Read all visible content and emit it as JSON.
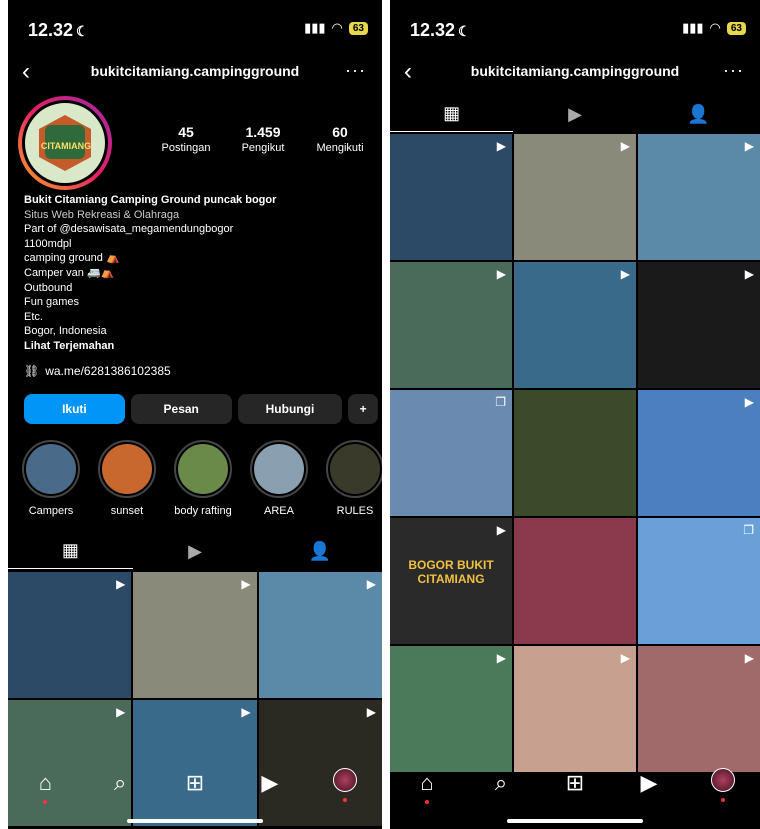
{
  "status": {
    "time": "12.32",
    "battery": "63"
  },
  "profile": {
    "username": "bukitcitamiang.campingground",
    "avatar_text": "CITAMIANG",
    "stats": [
      {
        "num": "45",
        "label": "Postingan"
      },
      {
        "num": "1.459",
        "label": "Pengikut"
      },
      {
        "num": "60",
        "label": "Mengikuti"
      }
    ],
    "bio": {
      "name": "Bukit Citamiang Camping Ground puncak bogor",
      "category": "Situs Web Rekreasi & Olahraga",
      "lines": [
        "Part of @desawisata_megamendungbogor",
        "1100mdpl",
        "camping ground ⛺",
        "Camper van 🚐⛺",
        "Outbound",
        "Fun games",
        "Etc.",
        "Bogor, Indonesia"
      ],
      "translate": "Lihat Terjemahan"
    },
    "link": "wa.me/6281386102385",
    "buttons": {
      "follow": "Ikuti",
      "message": "Pesan",
      "contact": "Hubungi",
      "add": "+"
    },
    "highlights": [
      {
        "label": "Campers",
        "color": "#4a6a8a"
      },
      {
        "label": "sunset",
        "color": "#c8682e"
      },
      {
        "label": "body rafting",
        "color": "#6a8a4a"
      },
      {
        "label": "AREA",
        "color": "#8aa0b0"
      },
      {
        "label": "RULES",
        "color": "#3a3a2a"
      }
    ]
  },
  "tabs": {
    "posts": "▦",
    "reels": "▶",
    "tagged": "👤"
  },
  "left_grid": [
    {
      "color": "#2c4a66",
      "icon": "▶"
    },
    {
      "color": "#8a8a7a",
      "icon": "▶"
    },
    {
      "color": "#5a8aa8",
      "icon": "▶"
    },
    {
      "color": "#4a6a5a",
      "icon": "▶"
    },
    {
      "color": "#3a6a8a",
      "icon": "▶"
    },
    {
      "color": "#2a2a22",
      "icon": "▶"
    }
  ],
  "right_grid": [
    {
      "color": "#2c4a66",
      "icon": "▶"
    },
    {
      "color": "#8a8a7a",
      "icon": "▶"
    },
    {
      "color": "#5a8aa8",
      "icon": "▶"
    },
    {
      "color": "#4a6a5a",
      "icon": "▶"
    },
    {
      "color": "#3a6a8a",
      "icon": "▶"
    },
    {
      "color": "#1a1a1a",
      "icon": "▶"
    },
    {
      "color": "#6a8ab0",
      "icon": "❐"
    },
    {
      "color": "#3a4a2a",
      "icon": ""
    },
    {
      "color": "#4a80c0",
      "icon": "▶"
    },
    {
      "color": "#2a2a2a",
      "icon": "▶",
      "text": "BOGOR BUKIT CITAMIANG"
    },
    {
      "color": "#8a3a4a",
      "icon": ""
    },
    {
      "color": "#6aa0d8",
      "icon": "❐"
    },
    {
      "color": "#4a7a5a",
      "icon": "▶"
    },
    {
      "color": "#c8a090",
      "icon": "▶"
    },
    {
      "color": "#a06a6a",
      "icon": "▶"
    }
  ],
  "nav": {
    "home": "⌂",
    "search": "⌕",
    "create": "⊞",
    "reels": "▶",
    "profile": ""
  }
}
